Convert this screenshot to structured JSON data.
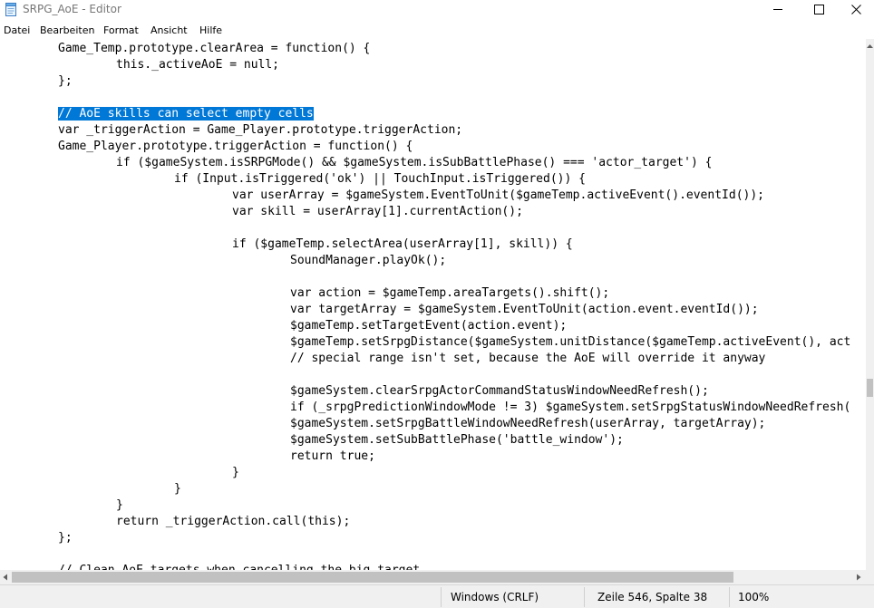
{
  "window": {
    "title": "SRPG_AoE - Editor",
    "icon": "notepad-icon",
    "controls": [
      "minimize-icon",
      "maximize-icon",
      "close-icon"
    ]
  },
  "menu": {
    "items": [
      "Datei",
      "Bearbeiten",
      "Format",
      "Ansicht",
      "Hilfe"
    ]
  },
  "editor": {
    "lines": [
      "\tGame_Temp.prototype.clearArea = function() {",
      "\t\tthis._activeAoE = null;",
      "\t};",
      "",
      "\t// AoE skills can select empty cells",
      "\tvar _triggerAction = Game_Player.prototype.triggerAction;",
      "\tGame_Player.prototype.triggerAction = function() {",
      "\t\tif ($gameSystem.isSRPGMode() && $gameSystem.isSubBattlePhase() === 'actor_target') {",
      "\t\t\tif (Input.isTriggered('ok') || TouchInput.isTriggered()) {",
      "\t\t\t\tvar userArray = $gameSystem.EventToUnit($gameTemp.activeEvent().eventId());",
      "\t\t\t\tvar skill = userArray[1].currentAction();",
      "",
      "\t\t\t\tif ($gameTemp.selectArea(userArray[1], skill)) {",
      "\t\t\t\t\tSoundManager.playOk();",
      "",
      "\t\t\t\t\tvar action = $gameTemp.areaTargets().shift();",
      "\t\t\t\t\tvar targetArray = $gameSystem.EventToUnit(action.event.eventId());",
      "\t\t\t\t\t$gameTemp.setTargetEvent(action.event);",
      "\t\t\t\t\t$gameTemp.setSrpgDistance($gameSystem.unitDistance($gameTemp.activeEvent(), act",
      "\t\t\t\t\t// special range isn't set, because the AoE will override it anyway",
      "",
      "\t\t\t\t\t$gameSystem.clearSrpgActorCommandStatusWindowNeedRefresh();",
      "\t\t\t\t\tif (_srpgPredictionWindowMode != 3) $gameSystem.setSrpgStatusWindowNeedRefresh(",
      "\t\t\t\t\t$gameSystem.setSrpgBattleWindowNeedRefresh(userArray, targetArray);",
      "\t\t\t\t\t$gameSystem.setSubBattlePhase('battle_window');",
      "\t\t\t\t\treturn true;",
      "\t\t\t\t}",
      "\t\t\t}",
      "\t\t}",
      "\t\treturn _triggerAction.call(this);",
      "\t};",
      "",
      "\t// Clean AoE targets when cancelling the big target"
    ],
    "selection": {
      "line": 4,
      "text": "// AoE skills can select empty cells"
    }
  },
  "status": {
    "line_ending": "Windows (CRLF)",
    "cursor": "Zeile 546, Spalte 38",
    "zoom": "100%"
  },
  "colors": {
    "selection_bg": "#0078d7",
    "selection_fg": "#ffffff",
    "statusbar_bg": "#f0f0f0",
    "scrollbar_thumb": "#c1c1c1"
  }
}
